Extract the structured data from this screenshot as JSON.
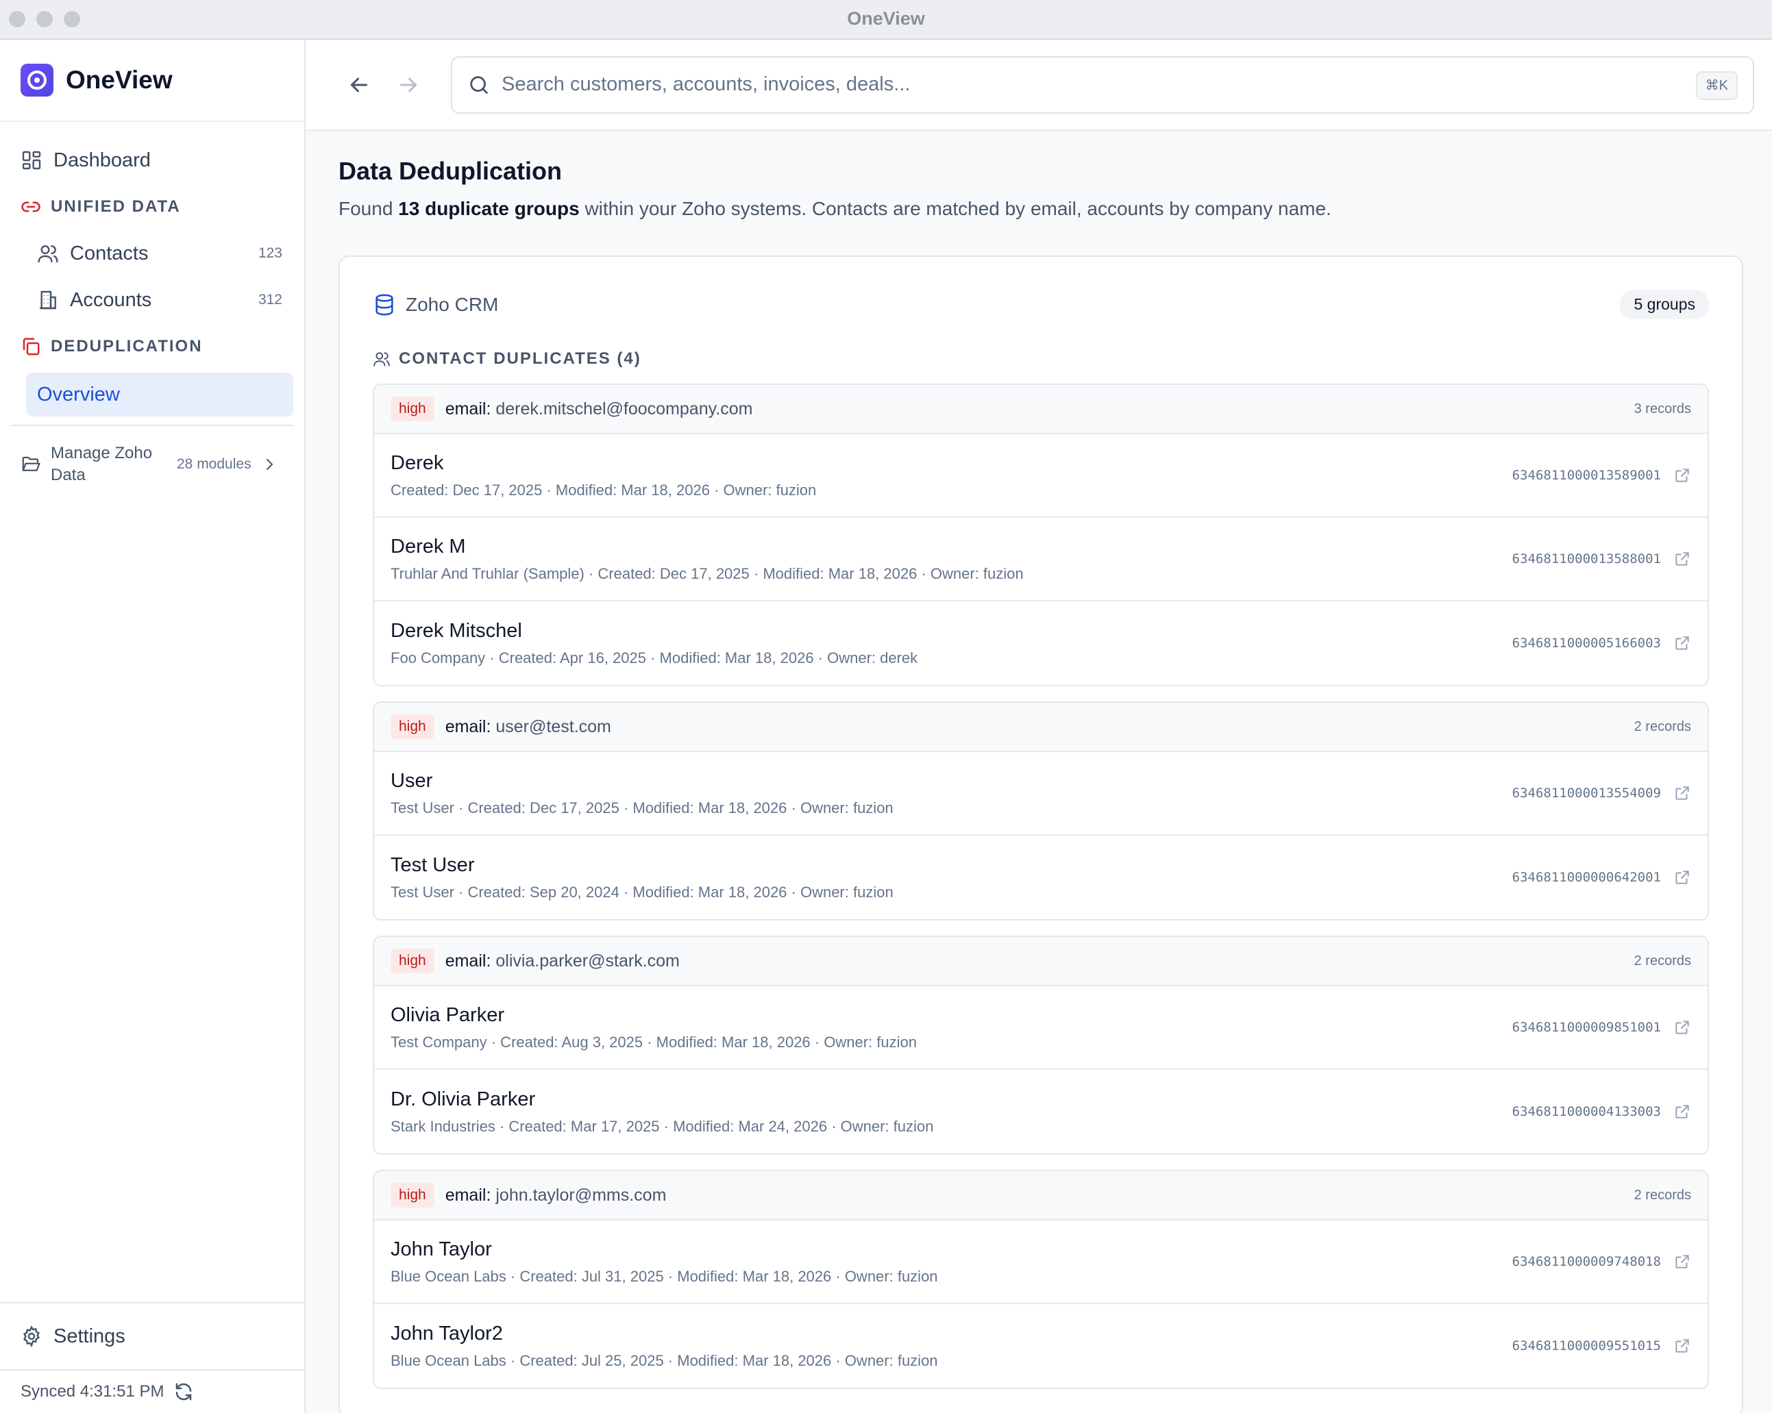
{
  "window": {
    "title": "OneView"
  },
  "sidebar": {
    "brand": "OneView",
    "dashboard": "Dashboard",
    "unified_section": "UNIFIED DATA",
    "contacts": {
      "label": "Contacts",
      "count": "123"
    },
    "accounts": {
      "label": "Accounts",
      "count": "312"
    },
    "dedup_section": "DEDUPLICATION",
    "overview": "Overview",
    "manage": {
      "label": "Manage Zoho Data",
      "modules": "28 modules"
    },
    "settings": "Settings",
    "synced": "Synced 4:31:51 PM"
  },
  "search": {
    "placeholder": "Search customers, accounts, invoices, deals...",
    "shortcut": "⌘K"
  },
  "page": {
    "title": "Data Deduplication",
    "sub_prefix": "Found ",
    "sub_bold": "13 duplicate groups",
    "sub_suffix": " within your Zoho systems. Contacts are matched by email, accounts by company name."
  },
  "panel": {
    "source": "Zoho CRM",
    "groups_badge": "5 groups",
    "section_label": "CONTACT DUPLICATES (4)",
    "groups": [
      {
        "confidence": "high",
        "field": "email",
        "value": "derek.mitschel@foocompany.com",
        "count": "3 records",
        "records": [
          {
            "name": "Derek",
            "meta": "Created: Dec 17, 2025 · Modified: Mar 18, 2026 · Owner: fuzion",
            "id": "6346811000013589001"
          },
          {
            "name": "Derek M",
            "meta": "Truhlar And Truhlar (Sample) · Created: Dec 17, 2025 · Modified: Mar 18, 2026 · Owner: fuzion",
            "id": "6346811000013588001"
          },
          {
            "name": "Derek Mitschel",
            "meta": "Foo Company · Created: Apr 16, 2025 · Modified: Mar 18, 2026 · Owner: derek",
            "id": "6346811000005166003"
          }
        ]
      },
      {
        "confidence": "high",
        "field": "email",
        "value": "user@test.com",
        "count": "2 records",
        "records": [
          {
            "name": "User",
            "meta": "Test User · Created: Dec 17, 2025 · Modified: Mar 18, 2026 · Owner: fuzion",
            "id": "6346811000013554009"
          },
          {
            "name": "Test User",
            "meta": "Test User · Created: Sep 20, 2024 · Modified: Mar 18, 2026 · Owner: fuzion",
            "id": "6346811000000642001"
          }
        ]
      },
      {
        "confidence": "high",
        "field": "email",
        "value": "olivia.parker@stark.com",
        "count": "2 records",
        "records": [
          {
            "name": "Olivia Parker",
            "meta": "Test Company · Created: Aug 3, 2025 · Modified: Mar 18, 2026 · Owner: fuzion",
            "id": "6346811000009851001"
          },
          {
            "name": "Dr. Olivia Parker",
            "meta": "Stark Industries · Created: Mar 17, 2025 · Modified: Mar 24, 2026 · Owner: fuzion",
            "id": "6346811000004133003"
          }
        ]
      },
      {
        "confidence": "high",
        "field": "email",
        "value": "john.taylor@mms.com",
        "count": "2 records",
        "records": [
          {
            "name": "John Taylor",
            "meta": "Blue Ocean Labs · Created: Jul 31, 2025 · Modified: Mar 18, 2026 · Owner: fuzion",
            "id": "6346811000009748018"
          },
          {
            "name": "John Taylor2",
            "meta": "Blue Ocean Labs · Created: Jul 25, 2025 · Modified: Mar 18, 2026 · Owner: fuzion",
            "id": "6346811000009551015"
          }
        ]
      }
    ]
  },
  "colors": {
    "accent": "#1d4ed8",
    "brand": "#5b43f0",
    "danger": "#dc2626",
    "badge_bg": "#fde8e8",
    "badge_text": "#b91c1c"
  },
  "icons": {
    "dashboard": "layout-grid-icon",
    "unified": "link-icon",
    "contacts": "users-icon",
    "accounts": "building-icon",
    "dedup": "copy-icon",
    "manage": "folder-open-icon",
    "settings": "gear-icon",
    "sync": "refresh-icon",
    "back": "arrow-left-icon",
    "forward": "arrow-right-icon",
    "search": "search-icon",
    "source": "database-icon",
    "external": "external-link-icon"
  }
}
